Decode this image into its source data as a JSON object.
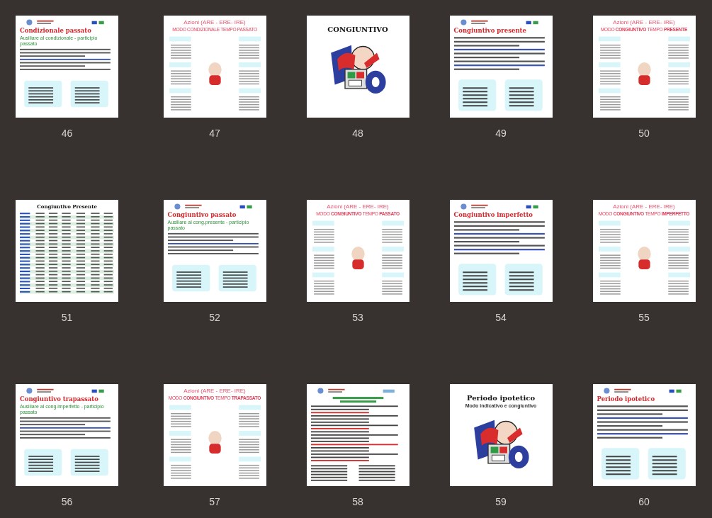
{
  "pages": [
    {
      "number": "46",
      "kind": "lesson",
      "title": "Condizionale passato",
      "subtitle": "Ausiliare al condizionale - participio passato"
    },
    {
      "number": "47",
      "kind": "azioni",
      "title": "Azioni (ARE - ERE- IRE)",
      "mode": "MODO CONDIZIONALE TEMPO PASSATO"
    },
    {
      "number": "48",
      "kind": "cover",
      "title": "CONGIUNTIVO"
    },
    {
      "number": "49",
      "kind": "lesson",
      "title": "Congiuntivo presente"
    },
    {
      "number": "50",
      "kind": "azioni",
      "title": "Azioni (ARE - ERE- IRE)",
      "mode": "MODO **CONGIUNTIVO** TEMPO **PRESENTE**"
    },
    {
      "number": "51",
      "kind": "table",
      "title": "Congiuntivo Presente"
    },
    {
      "number": "52",
      "kind": "lesson",
      "title": "Congiuntivo passato",
      "subtitle": "Ausiliare al cong.presente - participio passato"
    },
    {
      "number": "53",
      "kind": "azioni",
      "title": "Azioni (ARE - ERE- IRE)",
      "mode": "MODO **CONGIUNTIVO** TEMPO **PASSATO**"
    },
    {
      "number": "54",
      "kind": "lesson",
      "title": "Congiuntivo imperfetto"
    },
    {
      "number": "55",
      "kind": "azioni",
      "title": "Azioni (ARE - ERE- IRE)",
      "mode": "MODO **CONGIUNTIVO** TEMPO **IMPERFETTO**"
    },
    {
      "number": "56",
      "kind": "lesson",
      "title": "Congiuntivo trapassato",
      "subtitle": "Ausiliare al cong.imperfetto - participio passato"
    },
    {
      "number": "57",
      "kind": "azioni",
      "title": "Azioni (ARE - ERE- IRE)",
      "mode": "MODO **CONGIUNTIVO** TEMPO **TRAPASSATO**"
    },
    {
      "number": "58",
      "kind": "list"
    },
    {
      "number": "59",
      "kind": "cover",
      "title": "Periodo ipotetico",
      "subtitle": "Modo indicativo e congiuntivo"
    },
    {
      "number": "60",
      "kind": "lesson",
      "title": "Periodo ipotetico"
    }
  ]
}
